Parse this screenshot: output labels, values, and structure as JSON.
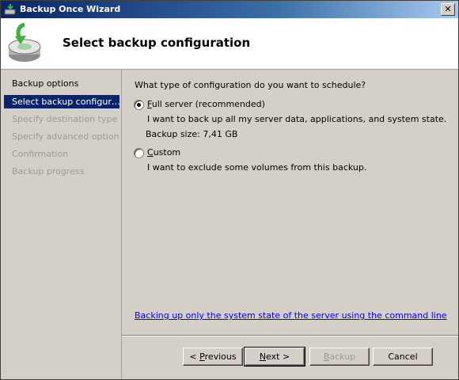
{
  "window": {
    "title": "Backup Once Wizard",
    "close_glyph": "✕"
  },
  "header": {
    "title": "Select backup configuration",
    "icon": "backup-disk-icon"
  },
  "sidebar": {
    "items": [
      {
        "label": "Backup options",
        "state": "normal"
      },
      {
        "label": "Select backup configur…",
        "state": "active"
      },
      {
        "label": "Specify destination type",
        "state": "disabled"
      },
      {
        "label": "Specify advanced option",
        "state": "disabled"
      },
      {
        "label": "Confirmation",
        "state": "disabled"
      },
      {
        "label": "Backup progress",
        "state": "disabled"
      }
    ]
  },
  "main": {
    "question": "What type of configuration do you want to schedule?",
    "options": [
      {
        "label_underlined": "F",
        "label_rest": "ull server (recommended)",
        "description": "I want to back up all my server data, applications, and system state.",
        "extra": "Backup size: 7,41 GB",
        "selected": true
      },
      {
        "label_underlined": "C",
        "label_rest": "ustom",
        "description": "I want to exclude some volumes from this backup.",
        "selected": false
      }
    ],
    "link": "Backing up only the system state of the server using the command line"
  },
  "buttons": {
    "previous": {
      "prefix": "< ",
      "underlined": "P",
      "rest": "revious"
    },
    "next": {
      "underlined": "N",
      "rest": "ext >"
    },
    "backup": {
      "underlined": "B",
      "rest": "ackup"
    },
    "cancel": "Cancel"
  },
  "colors": {
    "selection": "#0a246a",
    "link": "#0000ff",
    "disabled_text": "#9b9a96"
  }
}
